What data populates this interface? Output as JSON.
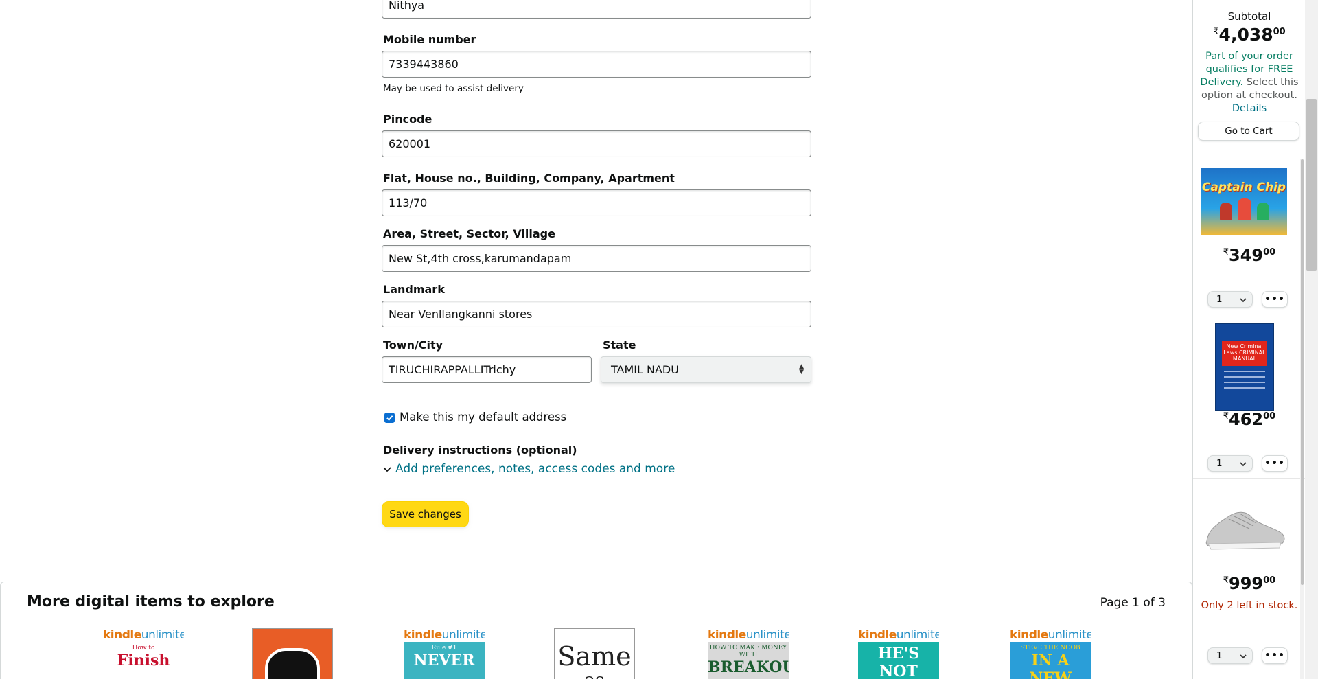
{
  "form": {
    "name_value": "Nithya",
    "mobile_label": "Mobile number",
    "mobile_value": "7339443860",
    "mobile_hint": "May be used to assist delivery",
    "pincode_label": "Pincode",
    "pincode_value": "620001",
    "flat_label": "Flat, House no., Building, Company, Apartment",
    "flat_value": "113/70",
    "area_label": "Area, Street, Sector, Village",
    "area_value": "New St,4th cross,karumandapam",
    "landmark_label": "Landmark",
    "landmark_value": "Near Venllangkanni stores",
    "city_label": "Town/City",
    "city_value": "TIRUCHIRAPPALLITrichy",
    "state_label": "State",
    "state_value": "TAMIL NADU",
    "default_label": "Make this my default address",
    "default_checked": true,
    "delivery_label": "Delivery instructions (optional)",
    "delivery_link": "Add preferences, notes, access codes and more",
    "save_label": "Save changes"
  },
  "carousel": {
    "title": "More digital items to explore",
    "page": "Page 1 of 3",
    "items": [
      {
        "kindle": true,
        "cover_text": "How to",
        "cover_text2": "Finish",
        "bg": "#ffffff",
        "fg": "#c8102e"
      },
      {
        "kindle": false,
        "cover_text": "",
        "cover_text2": "",
        "bg": "#e85d26",
        "fg": "#ffffff"
      },
      {
        "kindle": true,
        "cover_text": "Rule #1",
        "cover_text2": "NEVER",
        "bg": "#3bb4c1",
        "fg": "#ffffff"
      },
      {
        "kindle": false,
        "cover_text": "Same",
        "cover_text2": "as",
        "bg": "#ffffff",
        "fg": "#222222"
      },
      {
        "kindle": true,
        "cover_text": "HOW TO MAKE MONEY WITH",
        "cover_text2": "BREAKOUT",
        "bg": "#d9d9d9",
        "fg": "#1a5c2e"
      },
      {
        "kindle": true,
        "cover_text": "",
        "cover_text2": "HE'S NOT",
        "bg": "#17b3a8",
        "fg": "#ffffff"
      },
      {
        "kindle": true,
        "cover_text": "STEVE THE NOOB",
        "cover_text2": "IN A NEW WORLD",
        "bg": "#2a9ed8",
        "fg": "#f7d117"
      }
    ],
    "kindle_word1": "kindle",
    "kindle_word2": "unlimited"
  },
  "cart": {
    "subtotal_label": "Subtotal",
    "currency": "₹",
    "subtotal_whole": "4,038",
    "subtotal_fraction": "00",
    "free_part1": "Part of your order qualifies for FREE Delivery.",
    "free_part2": " Select this option at checkout.",
    "details": "Details",
    "go_to_cart": "Go to Cart",
    "items": [
      {
        "price_whole": "349",
        "price_fraction": "00",
        "qty": "1",
        "cover_title": "Captain Chip",
        "stock": ""
      },
      {
        "price_whole": "462",
        "price_fraction": "00",
        "qty": "1",
        "cover_title": "New Criminal Laws CRIMINAL MANUAL",
        "stock": ""
      },
      {
        "price_whole": "999",
        "price_fraction": "00",
        "qty": "1",
        "cover_title": "",
        "stock": "Only 2 left in stock."
      }
    ],
    "more_label": "•••"
  },
  "colors": {
    "link": "#007185",
    "button_yellow": "#ffd814",
    "green": "#067d62",
    "stock_red": "#b12704"
  }
}
